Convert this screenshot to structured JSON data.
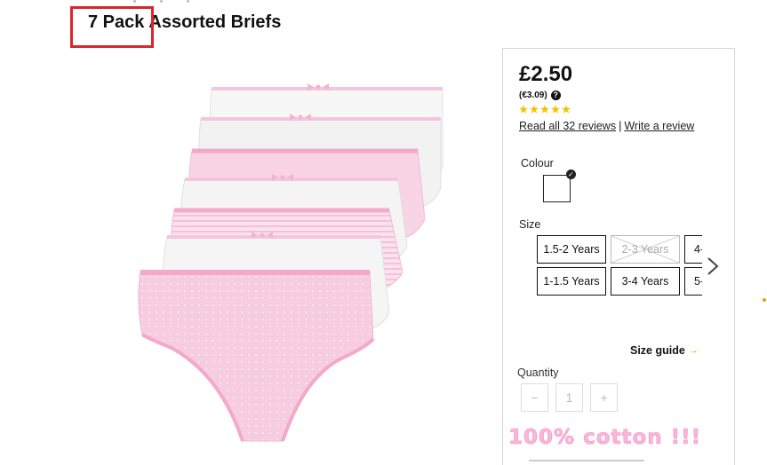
{
  "product": {
    "title_first": "7 Pack",
    "title_rest": "Assorted Briefs",
    "image_name": "pink-and-white-briefs"
  },
  "pricing": {
    "price": "£2.50",
    "alt_price": "(€3.09)",
    "rating": 5,
    "rating_max": 5,
    "star_color": "#f2c200",
    "read_reviews": "Read all 32 reviews",
    "separator": "|",
    "write_review": "Write a review"
  },
  "colour": {
    "label": "Colour",
    "selected_swatch": "#ffffff"
  },
  "size": {
    "label": "Size",
    "options": [
      {
        "label": "1.5-2 Years",
        "available": true
      },
      {
        "label": "2-3 Years",
        "available": false
      },
      {
        "label": "4-",
        "available": true
      },
      {
        "label": "1-1.5 Years",
        "available": true
      },
      {
        "label": "3-4 Years",
        "available": true
      },
      {
        "label": "5-",
        "available": true
      }
    ],
    "guide": "Size guide"
  },
  "quantity": {
    "label": "Quantity",
    "minus": "−",
    "value": "1",
    "plus": "+"
  },
  "overlay": {
    "text": "100% cotton !!!",
    "color": "#f9b6da",
    "highlight_color": "#d7262d"
  }
}
